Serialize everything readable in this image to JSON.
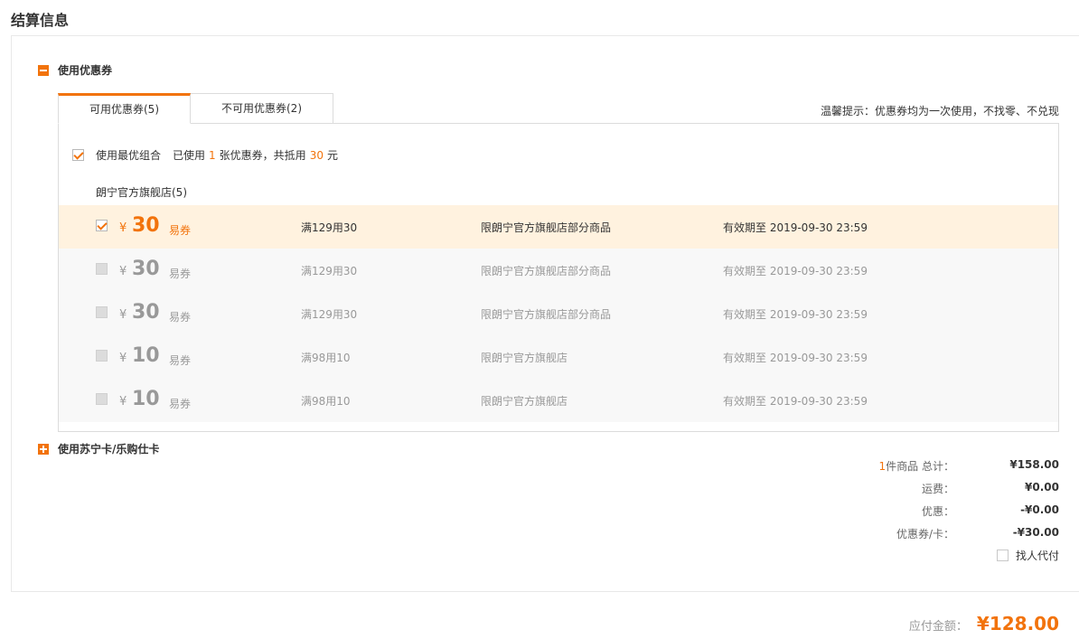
{
  "page_title": "结算信息",
  "coupon_section": {
    "label": "使用优惠券",
    "tabs": [
      {
        "label": "可用优惠券(5)",
        "active": true
      },
      {
        "label": "不可用优惠券(2)",
        "active": false
      }
    ],
    "tip": "温馨提示：优惠券均为一次使用，不找零、不兑现",
    "best_combo": {
      "label": "使用最优组合",
      "used_prefix": "已使用",
      "used_count": "1",
      "used_middle": "张优惠券，共抵用",
      "used_amount": "30",
      "used_suffix": "元"
    },
    "store_name": "朗宁官方旗舰店(5)",
    "coupons": [
      {
        "currency": "¥",
        "amount": "30",
        "type": "易券",
        "condition": "满129用30",
        "scope": "限朗宁官方旗舰店部分商品",
        "validity": "有效期至 2019-09-30 23:59",
        "checked": true
      },
      {
        "currency": "¥",
        "amount": "30",
        "type": "易券",
        "condition": "满129用30",
        "scope": "限朗宁官方旗舰店部分商品",
        "validity": "有效期至 2019-09-30 23:59",
        "checked": false
      },
      {
        "currency": "¥",
        "amount": "30",
        "type": "易券",
        "condition": "满129用30",
        "scope": "限朗宁官方旗舰店部分商品",
        "validity": "有效期至 2019-09-30 23:59",
        "checked": false
      },
      {
        "currency": "¥",
        "amount": "10",
        "type": "易券",
        "condition": "满98用10",
        "scope": "限朗宁官方旗舰店",
        "validity": "有效期至 2019-09-30 23:59",
        "checked": false
      },
      {
        "currency": "¥",
        "amount": "10",
        "type": "易券",
        "condition": "满98用10",
        "scope": "限朗宁官方旗舰店",
        "validity": "有效期至 2019-09-30 23:59",
        "checked": false
      }
    ]
  },
  "card_section": {
    "label": "使用苏宁卡/乐购仕卡"
  },
  "summary": {
    "item_count": "1",
    "items_label": "件商品  总计：",
    "items_total": "¥158.00",
    "shipping_label": "运费：",
    "shipping": "¥0.00",
    "discount_label": "优惠：",
    "discount": "-¥0.00",
    "coupon_label": "优惠券/卡：",
    "coupon_value": "-¥30.00",
    "proxy_pay_label": "找人代付"
  },
  "total": {
    "label": "应付金额：",
    "value": "¥128.00"
  },
  "colors": {
    "accent": "#f2730c",
    "selected_row_bg": "#fff2df",
    "row_bg": "#f8f8f8"
  }
}
